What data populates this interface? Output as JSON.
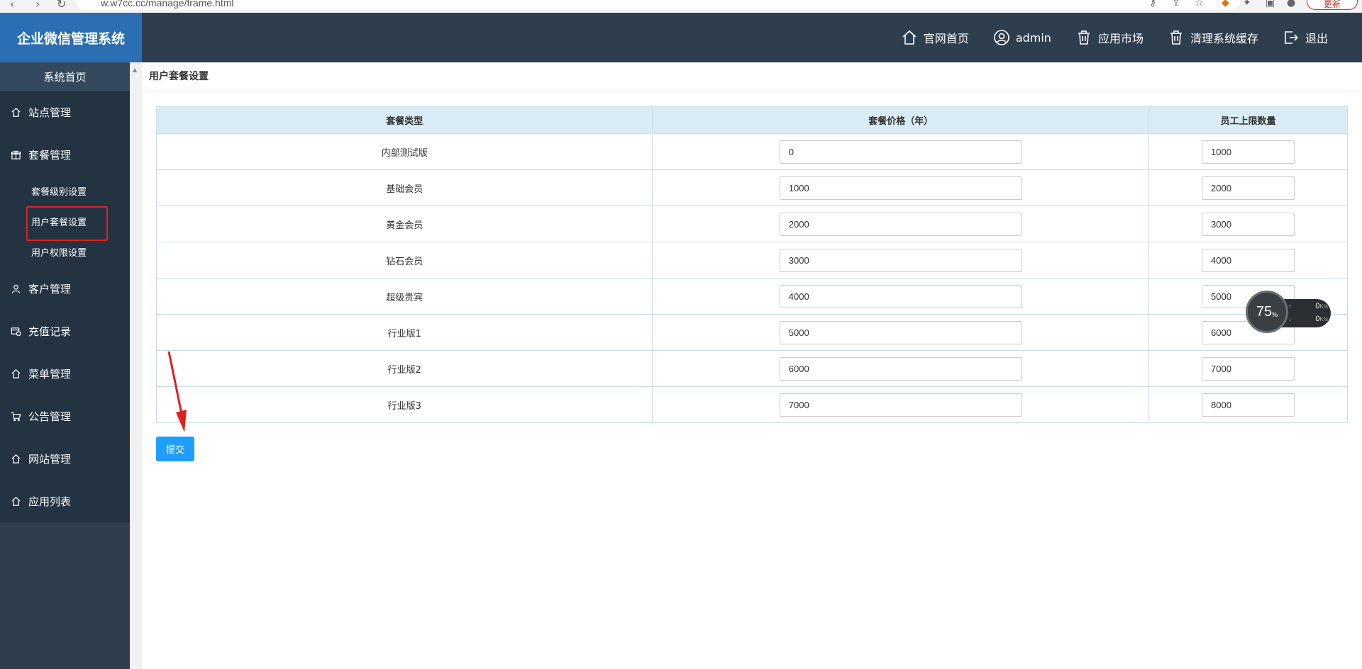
{
  "browser": {
    "url": "w.w7cc.cc/manage/frame.html",
    "update_label": "更新"
  },
  "header": {
    "logo": "企业微信管理系统",
    "nav": [
      {
        "label": "官网首页",
        "icon": "home-icon"
      },
      {
        "label": "admin",
        "icon": "user-icon"
      },
      {
        "label": "应用市场",
        "icon": "trash-icon"
      },
      {
        "label": "清理系统缓存",
        "icon": "trash-icon"
      },
      {
        "label": "退出",
        "icon": "logout-icon"
      }
    ]
  },
  "sidebar": {
    "home": "系统首页",
    "items": [
      {
        "label": "站点管理",
        "icon": "home-icon"
      },
      {
        "label": "套餐管理",
        "icon": "gift-icon"
      },
      {
        "label": "客户管理",
        "icon": "user-icon"
      },
      {
        "label": "充值记录",
        "icon": "recharge-icon"
      },
      {
        "label": "菜单管理",
        "icon": "home-icon"
      },
      {
        "label": "公告管理",
        "icon": "cart-icon"
      },
      {
        "label": "网站管理",
        "icon": "home-icon"
      },
      {
        "label": "应用列表",
        "icon": "home-icon"
      }
    ],
    "subitems": [
      {
        "label": "套餐级别设置"
      },
      {
        "label": "用户套餐设置",
        "active": true
      },
      {
        "label": "用户权限设置"
      }
    ]
  },
  "main": {
    "title": "用户套餐设置",
    "table": {
      "headers": [
        "套餐类型",
        "套餐价格（年）",
        "员工上限数量"
      ],
      "rows": [
        {
          "type": "内部测试版",
          "price": "0",
          "staff": "1000"
        },
        {
          "type": "基础会员",
          "price": "1000",
          "staff": "2000"
        },
        {
          "type": "黄金会员",
          "price": "2000",
          "staff": "3000"
        },
        {
          "type": "钻石会员",
          "price": "3000",
          "staff": "4000"
        },
        {
          "type": "超级贵宾",
          "price": "4000",
          "staff": "5000"
        },
        {
          "type": "行业版1",
          "price": "5000",
          "staff": "6000"
        },
        {
          "type": "行业版2",
          "price": "6000",
          "staff": "7000"
        },
        {
          "type": "行业版3",
          "price": "7000",
          "staff": "8000"
        }
      ]
    },
    "submit_label": "提交"
  },
  "net_widget": {
    "percent": "75",
    "percent_unit": "%",
    "up_value": "0",
    "down_value": "0",
    "unit": "K/s"
  },
  "colors": {
    "header_bg": "#2e3e4f",
    "logo_bg": "#2a6fb3",
    "submit_bg": "#1e9fff",
    "table_header_bg": "#d9ecf5",
    "annotation_red": "#e0201f"
  }
}
